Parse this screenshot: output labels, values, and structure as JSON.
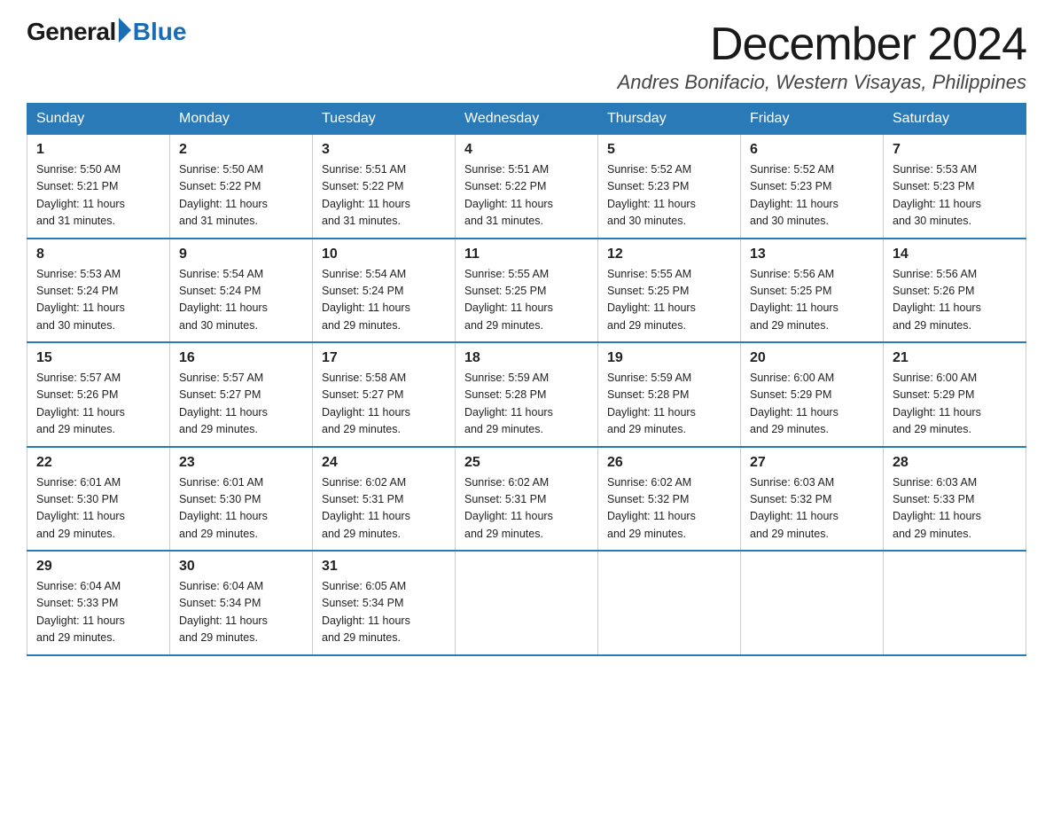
{
  "header": {
    "logo_general": "General",
    "logo_blue": "Blue",
    "month_title": "December 2024",
    "location": "Andres Bonifacio, Western Visayas, Philippines"
  },
  "weekdays": [
    "Sunday",
    "Monday",
    "Tuesday",
    "Wednesday",
    "Thursday",
    "Friday",
    "Saturday"
  ],
  "weeks": [
    [
      {
        "day": "1",
        "sunrise": "5:50 AM",
        "sunset": "5:21 PM",
        "daylight": "11 hours and 31 minutes."
      },
      {
        "day": "2",
        "sunrise": "5:50 AM",
        "sunset": "5:22 PM",
        "daylight": "11 hours and 31 minutes."
      },
      {
        "day": "3",
        "sunrise": "5:51 AM",
        "sunset": "5:22 PM",
        "daylight": "11 hours and 31 minutes."
      },
      {
        "day": "4",
        "sunrise": "5:51 AM",
        "sunset": "5:22 PM",
        "daylight": "11 hours and 31 minutes."
      },
      {
        "day": "5",
        "sunrise": "5:52 AM",
        "sunset": "5:23 PM",
        "daylight": "11 hours and 30 minutes."
      },
      {
        "day": "6",
        "sunrise": "5:52 AM",
        "sunset": "5:23 PM",
        "daylight": "11 hours and 30 minutes."
      },
      {
        "day": "7",
        "sunrise": "5:53 AM",
        "sunset": "5:23 PM",
        "daylight": "11 hours and 30 minutes."
      }
    ],
    [
      {
        "day": "8",
        "sunrise": "5:53 AM",
        "sunset": "5:24 PM",
        "daylight": "11 hours and 30 minutes."
      },
      {
        "day": "9",
        "sunrise": "5:54 AM",
        "sunset": "5:24 PM",
        "daylight": "11 hours and 30 minutes."
      },
      {
        "day": "10",
        "sunrise": "5:54 AM",
        "sunset": "5:24 PM",
        "daylight": "11 hours and 29 minutes."
      },
      {
        "day": "11",
        "sunrise": "5:55 AM",
        "sunset": "5:25 PM",
        "daylight": "11 hours and 29 minutes."
      },
      {
        "day": "12",
        "sunrise": "5:55 AM",
        "sunset": "5:25 PM",
        "daylight": "11 hours and 29 minutes."
      },
      {
        "day": "13",
        "sunrise": "5:56 AM",
        "sunset": "5:25 PM",
        "daylight": "11 hours and 29 minutes."
      },
      {
        "day": "14",
        "sunrise": "5:56 AM",
        "sunset": "5:26 PM",
        "daylight": "11 hours and 29 minutes."
      }
    ],
    [
      {
        "day": "15",
        "sunrise": "5:57 AM",
        "sunset": "5:26 PM",
        "daylight": "11 hours and 29 minutes."
      },
      {
        "day": "16",
        "sunrise": "5:57 AM",
        "sunset": "5:27 PM",
        "daylight": "11 hours and 29 minutes."
      },
      {
        "day": "17",
        "sunrise": "5:58 AM",
        "sunset": "5:27 PM",
        "daylight": "11 hours and 29 minutes."
      },
      {
        "day": "18",
        "sunrise": "5:59 AM",
        "sunset": "5:28 PM",
        "daylight": "11 hours and 29 minutes."
      },
      {
        "day": "19",
        "sunrise": "5:59 AM",
        "sunset": "5:28 PM",
        "daylight": "11 hours and 29 minutes."
      },
      {
        "day": "20",
        "sunrise": "6:00 AM",
        "sunset": "5:29 PM",
        "daylight": "11 hours and 29 minutes."
      },
      {
        "day": "21",
        "sunrise": "6:00 AM",
        "sunset": "5:29 PM",
        "daylight": "11 hours and 29 minutes."
      }
    ],
    [
      {
        "day": "22",
        "sunrise": "6:01 AM",
        "sunset": "5:30 PM",
        "daylight": "11 hours and 29 minutes."
      },
      {
        "day": "23",
        "sunrise": "6:01 AM",
        "sunset": "5:30 PM",
        "daylight": "11 hours and 29 minutes."
      },
      {
        "day": "24",
        "sunrise": "6:02 AM",
        "sunset": "5:31 PM",
        "daylight": "11 hours and 29 minutes."
      },
      {
        "day": "25",
        "sunrise": "6:02 AM",
        "sunset": "5:31 PM",
        "daylight": "11 hours and 29 minutes."
      },
      {
        "day": "26",
        "sunrise": "6:02 AM",
        "sunset": "5:32 PM",
        "daylight": "11 hours and 29 minutes."
      },
      {
        "day": "27",
        "sunrise": "6:03 AM",
        "sunset": "5:32 PM",
        "daylight": "11 hours and 29 minutes."
      },
      {
        "day": "28",
        "sunrise": "6:03 AM",
        "sunset": "5:33 PM",
        "daylight": "11 hours and 29 minutes."
      }
    ],
    [
      {
        "day": "29",
        "sunrise": "6:04 AM",
        "sunset": "5:33 PM",
        "daylight": "11 hours and 29 minutes."
      },
      {
        "day": "30",
        "sunrise": "6:04 AM",
        "sunset": "5:34 PM",
        "daylight": "11 hours and 29 minutes."
      },
      {
        "day": "31",
        "sunrise": "6:05 AM",
        "sunset": "5:34 PM",
        "daylight": "11 hours and 29 minutes."
      },
      null,
      null,
      null,
      null
    ]
  ],
  "labels": {
    "sunrise": "Sunrise:",
    "sunset": "Sunset:",
    "daylight": "Daylight:"
  }
}
